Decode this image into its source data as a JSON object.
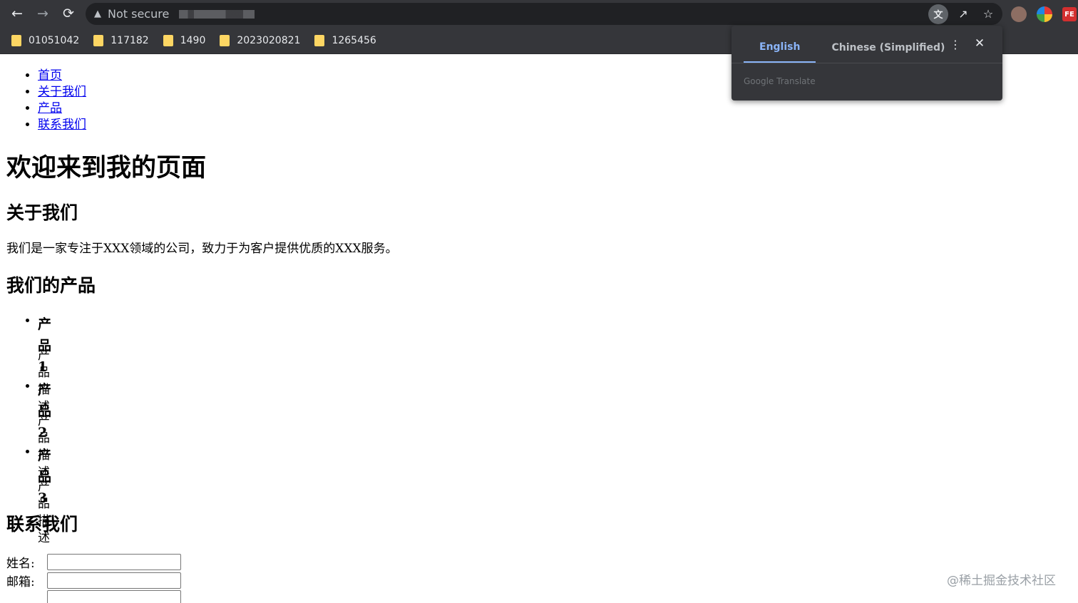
{
  "browser": {
    "security_text": "Not secure",
    "bookmarks": [
      "01051042",
      "117182",
      "1490",
      "2023020821",
      "1265456"
    ],
    "translate_popup": {
      "tabs": [
        {
          "label": "English",
          "active": true
        },
        {
          "label": "Chinese (Simplified)",
          "active": false
        }
      ],
      "brand": "Google Translate"
    },
    "extensions": [
      "owl-icon",
      "colorful-ball-icon",
      "fe-icon"
    ],
    "fe_label": "FE"
  },
  "page": {
    "nav": [
      "首页",
      "关于我们",
      "产品",
      "联系我们"
    ],
    "title": "欢迎来到我的页面",
    "about": {
      "heading": "关于我们",
      "text": "我们是一家专注于XXX领域的公司，致力于为客户提供优质的XXX服务。"
    },
    "products": {
      "heading": "我们的产品",
      "items": [
        {
          "name": "产品1",
          "desc": "产品描述"
        },
        {
          "name": "产品2",
          "desc": "产品描述"
        },
        {
          "name": "产品3",
          "desc": "产品描述"
        }
      ]
    },
    "contact": {
      "heading": "联系我们",
      "name_label": "姓名:",
      "email_label": "邮箱:"
    }
  },
  "watermark": "@稀土掘金技术社区",
  "colors": {
    "chrome_bg": "#35363a",
    "omnibox_bg": "#202124",
    "link": "#0000ee",
    "translate_accent": "#8ab4f8",
    "folder": "#fdd663"
  }
}
